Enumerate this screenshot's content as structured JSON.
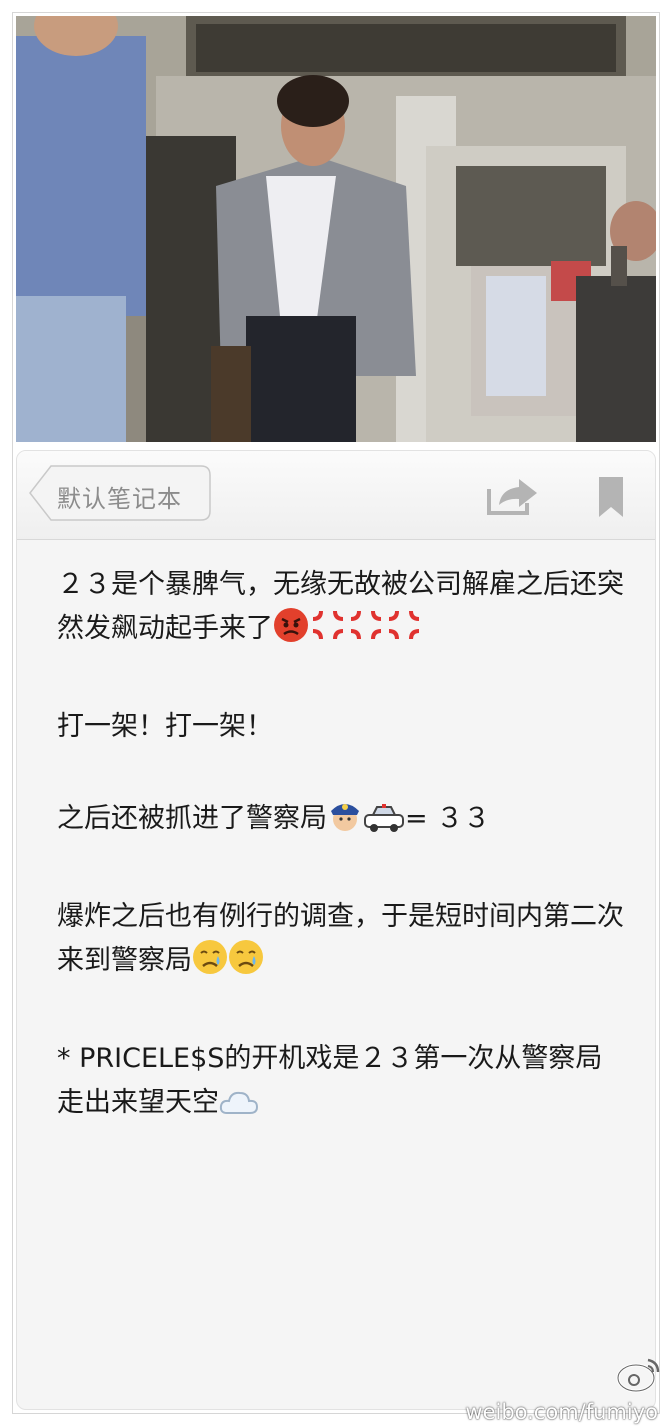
{
  "toolbar": {
    "back_label": "默认笔记本",
    "back_icon": "chevron-left-icon",
    "share_icon": "share-icon",
    "bookmark_icon": "bookmark-icon"
  },
  "note": {
    "p1_text": "２３是个暴脾气，无缘无故被公司解雇之后还突然发飙动起手来了",
    "p2_text": "打一架！打一架！",
    "p3_text_a": "之后还被抓进了警察局",
    "p3_text_b": "= ３３",
    "p4_text": "爆炸之后也有例行的调查，于是短时间内第二次来到警察局",
    "p5_text": "* PRICELE$S的开机戏是２３第一次从警察局走出来望天空"
  },
  "watermark": {
    "text": "weibo.com/fumiyo"
  }
}
